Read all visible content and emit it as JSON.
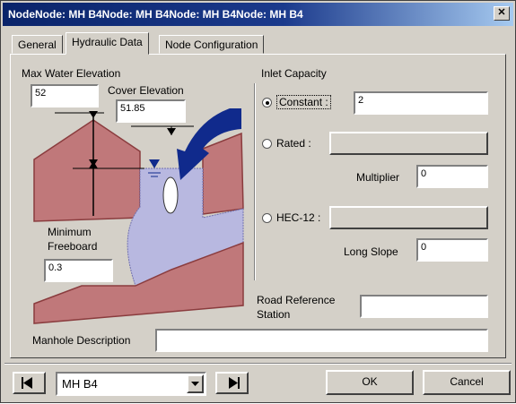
{
  "window": {
    "title": "NodeNode: MH B4Node: MH B4Node: MH B4Node: MH B4"
  },
  "tabs": [
    {
      "label": "General"
    },
    {
      "label": "Hydraulic Data"
    },
    {
      "label": "Node Configuration"
    }
  ],
  "hydraulic": {
    "max_water_elevation_label": "Max Water Elevation",
    "max_water_elevation_value": "52",
    "cover_elevation_label": "Cover Elevation",
    "cover_elevation_value": "51.85",
    "minimum_freeboard_label": "Minimum\nFreeboard",
    "minimum_freeboard_value": "0.3"
  },
  "inlet_capacity": {
    "group_label": "Inlet Capacity",
    "constant_label": "Constant :",
    "constant_value": "2",
    "rated_label": "Rated :",
    "multiplier_label": "Multiplier",
    "multiplier_value": "0",
    "hec12_label": "HEC-12 :",
    "long_slope_label": "Long Slope",
    "long_slope_value": "0",
    "selected": "constant"
  },
  "road_reference": {
    "label": "Road Reference\nStation",
    "value": ""
  },
  "manhole": {
    "label": "Manhole Description",
    "value": ""
  },
  "footer": {
    "node_selected": "MH B4",
    "ok_label": "OK",
    "cancel_label": "Cancel"
  },
  "colors": {
    "title_bar": "#0a246a",
    "ground_fill": "#c0787a",
    "water_fill": "#b8b8e0",
    "arrow_fill": "#102a8c"
  }
}
